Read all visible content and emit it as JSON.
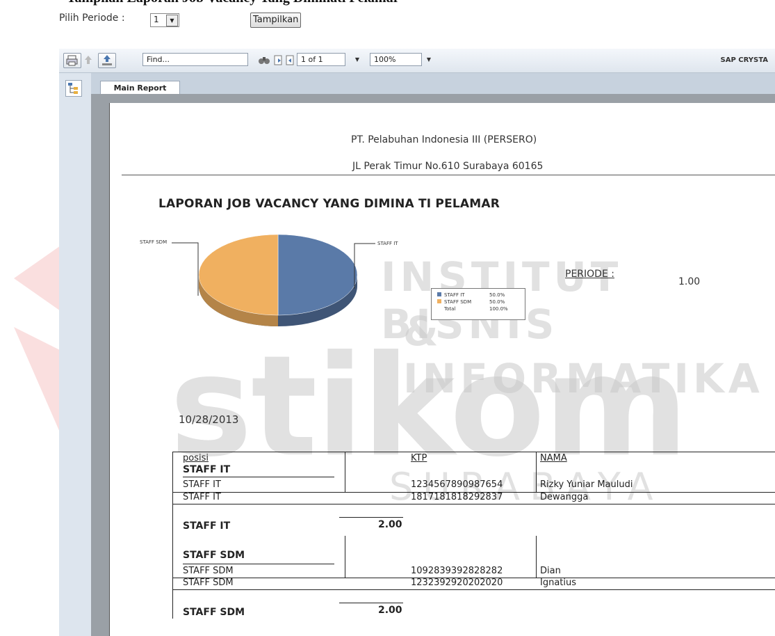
{
  "heading_fragment": "Tampilan Laporan Job Vacancy Yang Diminati Pelamar",
  "period_bar": {
    "label": "Pilih Periode :",
    "selected": "1",
    "button": "Tampilkan"
  },
  "toolbar": {
    "find_placeholder": "Find...",
    "page": "1 of 1",
    "zoom": "100%",
    "brand": "SAP CRYSTA"
  },
  "tabs": [
    "Main Report"
  ],
  "report": {
    "company": "PT. Pelabuhan Indonesia III (PERSERO)",
    "address": "JL Perak Timur No.610 Surabaya 60165",
    "title": "LAPORAN JOB VACANCY YANG DIMINA TI PELAMAR",
    "periode_label": "PERIODE :",
    "periode_value": "1.00",
    "date": "10/28/2013"
  },
  "chart_data": {
    "type": "pie",
    "categories": [
      "STAFF IT",
      "STAFF SDM"
    ],
    "values": [
      50.0,
      50.0
    ],
    "colors": [
      "#5a7aa8",
      "#f0b060"
    ],
    "legend": {
      "entries": [
        {
          "label": "STAFF IT",
          "value": "50.0%"
        },
        {
          "label": "STAFF SDM",
          "value": "50.0%"
        },
        {
          "label": "Total",
          "value": "100.0%"
        }
      ]
    },
    "slice_labels": [
      "STAFF IT",
      "STAFF SDM"
    ]
  },
  "table": {
    "headers": {
      "posisi": "posisi",
      "ktp": "KTP",
      "nama": "NAMA"
    },
    "groups": [
      {
        "name": "STAFF IT",
        "rows": [
          {
            "posisi": "STAFF IT",
            "ktp": "1234567890987654",
            "nama": "Rizky Yuniar Mauludi"
          },
          {
            "posisi": "STAFF IT",
            "ktp": "1817181818292837",
            "nama": "Dewangga"
          }
        ],
        "footer_label": "STAFF IT",
        "count": "2.00"
      },
      {
        "name": "STAFF SDM",
        "rows": [
          {
            "posisi": "STAFF SDM",
            "ktp": "1092839392828282",
            "nama": "Dian"
          },
          {
            "posisi": "STAFF SDM",
            "ktp": "1232392920202020",
            "nama": "Ignatius"
          }
        ],
        "footer_label": "STAFF SDM",
        "count": "2.00"
      }
    ]
  },
  "watermark": {
    "line1": "INSTITUT BISNIS",
    "line2": "& INFORMATIKA",
    "logo": "stikom",
    "line3": "SURABAYA"
  }
}
